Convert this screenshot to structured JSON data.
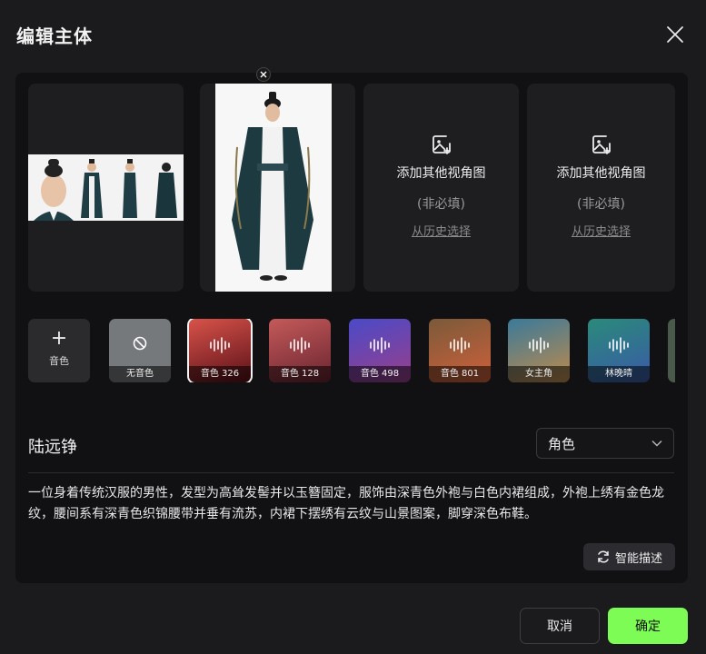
{
  "dialog": {
    "title": "编辑主体"
  },
  "views": {
    "add_title": "添加其他视角图",
    "optional": "(非必填)",
    "history": "从历史选择"
  },
  "voices": {
    "add_label": "音色",
    "items": [
      {
        "label": "无音色",
        "type": "none"
      },
      {
        "label": "音色 326",
        "type": "voice",
        "selected": true,
        "gradient": [
          "#d8534a",
          "#5a1018"
        ]
      },
      {
        "label": "音色 128",
        "type": "voice",
        "gradient": [
          "#c45a5a",
          "#6a2430"
        ]
      },
      {
        "label": "音色 498",
        "type": "voice",
        "gradient": [
          "#4a4ac8",
          "#9a3f8a"
        ]
      },
      {
        "label": "音色 801",
        "type": "voice",
        "gradient": [
          "#7a5a3a",
          "#d0603a"
        ]
      },
      {
        "label": "女主角",
        "type": "voice",
        "gradient": [
          "#3a7a9a",
          "#c08a4a"
        ]
      },
      {
        "label": "林晚晴",
        "type": "voice",
        "gradient": [
          "#2a8a7a",
          "#3a5aa8"
        ]
      }
    ]
  },
  "subject": {
    "name": "陆远铮",
    "role": "角色",
    "description": "一位身着传统汉服的男性，发型为高耸发髻并以玉簪固定，服饰由深青色外袍与白色内裙组成，外袍上绣有金色龙纹，腰间系有深青色织锦腰带并垂有流苏，内裙下摆绣有云纹与山景图案，脚穿深色布鞋。",
    "smart_label": "智能描述"
  },
  "buttons": {
    "cancel": "取消",
    "ok": "确定"
  },
  "colors": {
    "accent": "#7cfc54",
    "panel": "#111114",
    "background": "#1b1b1d"
  }
}
